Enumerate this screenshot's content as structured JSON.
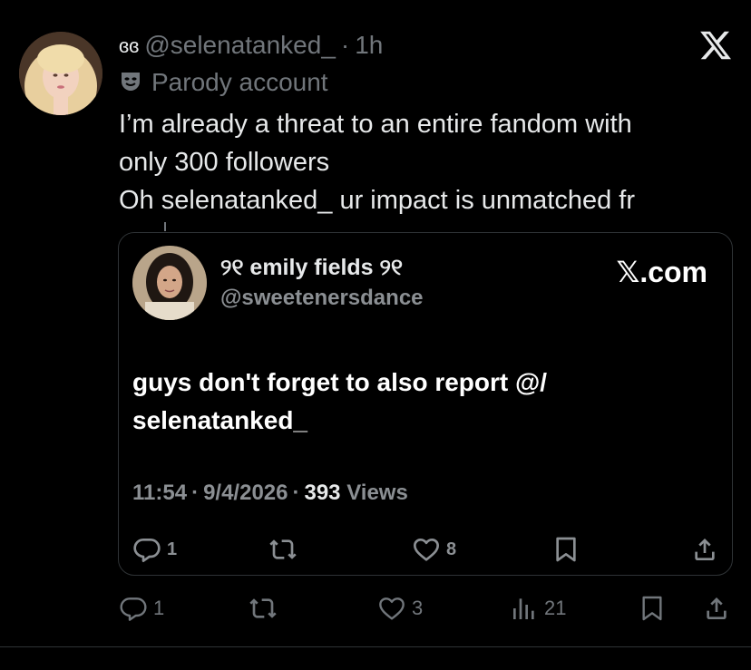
{
  "tweet": {
    "name_deco": "ɞɞ",
    "handle": "@selenatanked_",
    "separator": "·",
    "time": "1h",
    "close_icon": "x-logo-icon",
    "parody_icon": "mask-icon",
    "parody_label": "Parody account",
    "text_lines": [
      "I’m already a threat to an entire fandom with",
      "only 300 followers",
      "Oh selenatanked_ ur impact is unmatched fr"
    ],
    "actions": {
      "reply_count": "1",
      "retweet_count": "",
      "like_count": "3",
      "views_count": "21"
    }
  },
  "quote": {
    "name": "୨୧ emily fields ୨୧",
    "handle": "@sweetenersdance",
    "brand": "𝕏.com",
    "text_lines": [
      "guys don't forget to also report @/",
      "selenatanked_"
    ],
    "time": "11:54",
    "date": "9/4/2026",
    "views_count": "393",
    "views_label": "Views",
    "dot": "·",
    "actions": {
      "reply_count": "1",
      "retweet_count": "",
      "like_count": "8"
    }
  },
  "colors": {
    "background": "#000000",
    "text_primary": "#e7e9ea",
    "text_secondary": "#71767b",
    "border": "#2f3336"
  }
}
